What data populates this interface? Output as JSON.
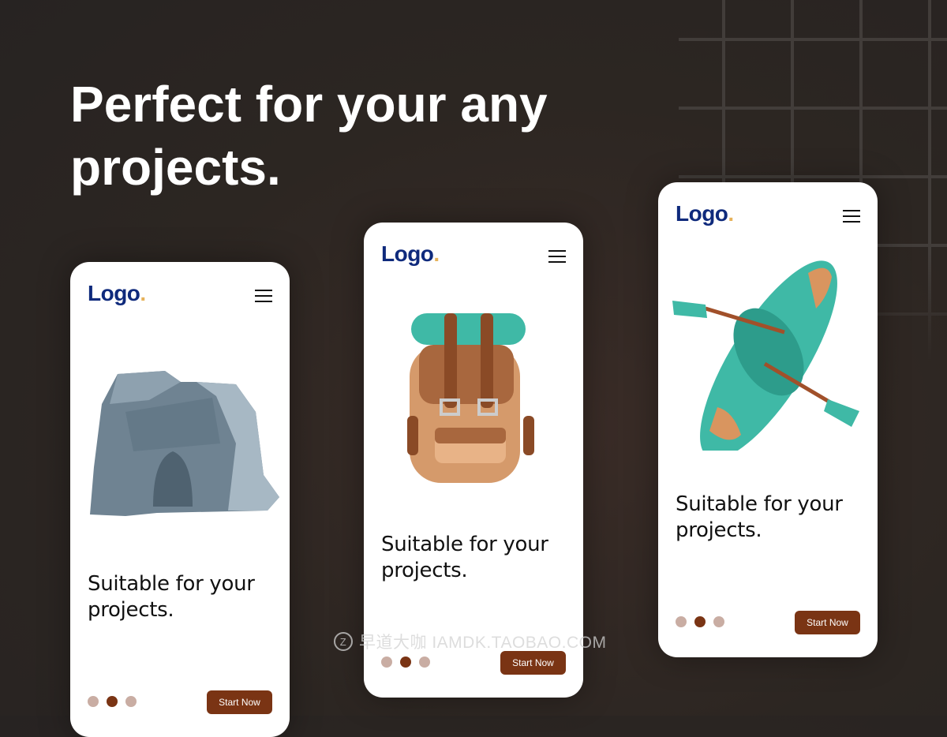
{
  "headline": "Perfect for your any projects.",
  "cards": [
    {
      "logo": "Logo",
      "logo_dot": ".",
      "illustration": "rock-icon",
      "heading": "Suitable for your projects.",
      "button": "Start Now",
      "active_dot": 2,
      "dot_count": 3
    },
    {
      "logo": "Logo",
      "logo_dot": ".",
      "illustration": "backpack-icon",
      "heading": "Suitable for your projects.",
      "button": "Start Now",
      "active_dot": 2,
      "dot_count": 3
    },
    {
      "logo": "Logo",
      "logo_dot": ".",
      "illustration": "kayak-icon",
      "heading": "Suitable for your projects.",
      "button": "Start Now",
      "active_dot": 2,
      "dot_count": 3
    }
  ],
  "watermark": "早道大咖  IAMDK.TAOBAO.COM",
  "colors": {
    "brand": "#0f2a7c",
    "accent": "#e6b25a",
    "button": "#7a3414",
    "dot_inactive": "#c9ada3"
  }
}
